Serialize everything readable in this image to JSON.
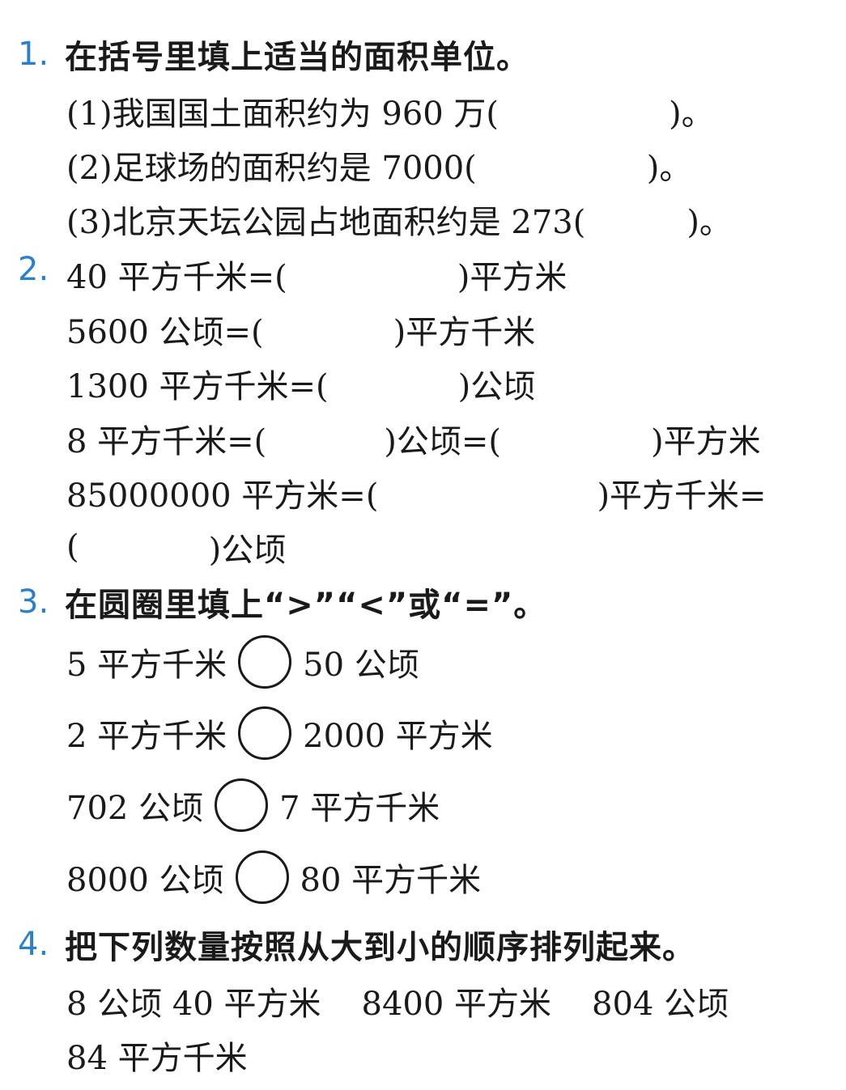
{
  "q1": {
    "num": "1.",
    "title": "在括号里填上适当的面积单位。",
    "items": [
      {
        "text": "(1)我国国土面积约为 960 万(",
        "close": ")。"
      },
      {
        "text": "(2)足球场的面积约是 7000(",
        "close": ")。"
      },
      {
        "text": "(3)北京天坛公园占地面积约是 273(",
        "close": ")。"
      }
    ]
  },
  "q2": {
    "num": "2.",
    "lines": [
      {
        "a": "40 平方千米=(",
        "b": ")平方米"
      },
      {
        "a": "5600 公顷=(",
        "b": ")平方千米"
      },
      {
        "a": "1300 平方千米=(",
        "b": ")公顷"
      },
      {
        "a": "8 平方千米=(",
        "b": ")公顷=(",
        "c": ")平方米"
      },
      {
        "a": "85000000 平方米=(",
        "b": ")平方千米="
      },
      {
        "a": "(",
        "b": ")公顷"
      }
    ]
  },
  "q3": {
    "num": "3.",
    "title": "在圆圈里填上“>”“<”或“=”。",
    "rows": [
      {
        "left": "5 平方千米",
        "right": "50 公顷"
      },
      {
        "left": "2 平方千米",
        "right": "2000 平方米"
      },
      {
        "left": "702 公顷",
        "right": "7 平方千米"
      },
      {
        "left": "8000 公顷",
        "right": "80 平方千米"
      }
    ]
  },
  "q4": {
    "num": "4.",
    "title": "把下列数量按照从大到小的顺序排列起来。",
    "items": [
      "8 公顷 40 平方米",
      "8400 平方米",
      "804 公顷",
      "84 平方千米"
    ]
  }
}
